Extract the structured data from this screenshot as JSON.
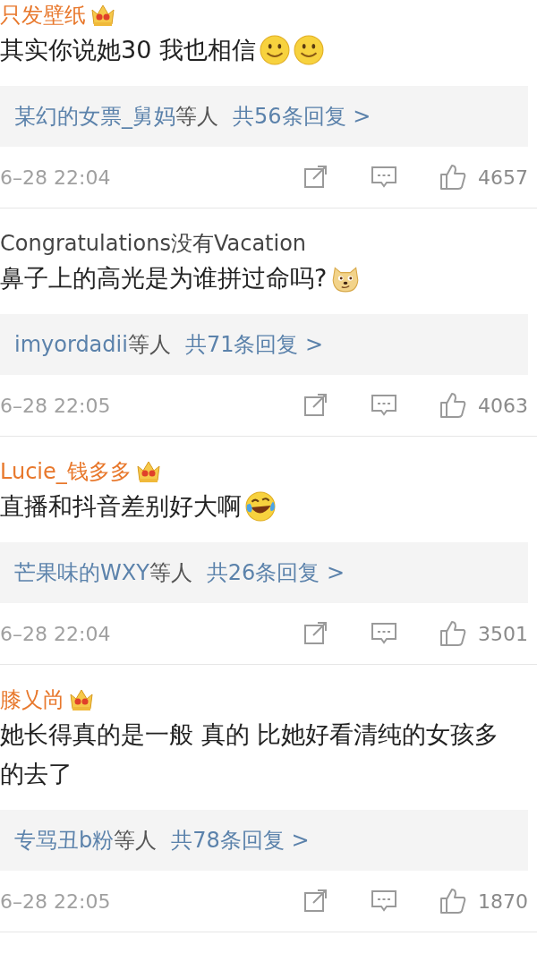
{
  "comments": [
    {
      "name": "只发壁纸",
      "vip": true,
      "text": "其实你说她30 我也相信",
      "emojis": [
        {
          "kind": "smile"
        },
        {
          "kind": "smile"
        }
      ],
      "replies": {
        "users": "某幻的女票_舅妈",
        "suffix": "等人",
        "count": "共56条回复 >"
      },
      "time": "6–28 22:04",
      "likes": "4657"
    },
    {
      "name": "Congratulations没有Vacation",
      "vip": false,
      "text": "鼻子上的高光是为谁拼过命吗?",
      "emojis": [
        {
          "kind": "doge"
        }
      ],
      "replies": {
        "users": "imyordadii",
        "suffix": "等人",
        "count": "共71条回复 >"
      },
      "time": "6–28 22:05",
      "likes": "4063"
    },
    {
      "name": "Lucie_钱多多",
      "vip": true,
      "text": "直播和抖音差别好大啊",
      "emojis": [
        {
          "kind": "laugh"
        }
      ],
      "replies": {
        "users": "芒果味的WXY",
        "suffix": "等人",
        "count": "共26条回复 >"
      },
      "time": "6–28 22:04",
      "likes": "3501"
    },
    {
      "name": "膝乂尚",
      "vip": true,
      "text": "她长得真的是一般 真的 比她好看清纯的女孩多的去了",
      "replies": {
        "users": "专骂丑b粉",
        "suffix": "等人",
        "count": "共78条回复 >"
      },
      "time": "6–28 22:05",
      "likes": "1870"
    }
  ]
}
